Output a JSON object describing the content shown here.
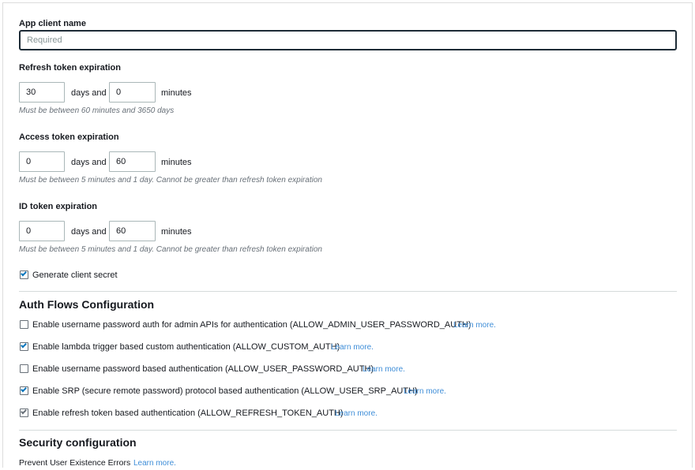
{
  "app_client": {
    "label": "App client name",
    "placeholder": "Required",
    "value": ""
  },
  "refresh_token": {
    "label": "Refresh token expiration",
    "days": "30",
    "days_suffix": "days and",
    "minutes": "0",
    "minutes_suffix": "minutes",
    "hint": "Must be between 60 minutes and 3650 days"
  },
  "access_token": {
    "label": "Access token expiration",
    "days": "0",
    "days_suffix": "days and",
    "minutes": "60",
    "minutes_suffix": "minutes",
    "hint": "Must be between 5 minutes and 1 day. Cannot be greater than refresh token expiration"
  },
  "id_token": {
    "label": "ID token expiration",
    "days": "0",
    "days_suffix": "days and",
    "minutes": "60",
    "minutes_suffix": "minutes",
    "hint": "Must be between 5 minutes and 1 day. Cannot be greater than refresh token expiration"
  },
  "client_secret": {
    "label": "Generate client secret",
    "checked": true
  },
  "auth_flows": {
    "heading": "Auth Flows Configuration",
    "items": [
      {
        "label": "Enable username password auth for admin APIs for authentication (ALLOW_ADMIN_USER_PASSWORD_AUTH)",
        "link": "Learn more.",
        "checked": false
      },
      {
        "label": "Enable lambda trigger based custom authentication (ALLOW_CUSTOM_AUTH)",
        "link": "Learn more.",
        "checked": true
      },
      {
        "label": "Enable username password based authentication (ALLOW_USER_PASSWORD_AUTH)",
        "link": "Learn more.",
        "checked": false
      },
      {
        "label": "Enable SRP (secure remote password) protocol based authentication (ALLOW_USER_SRP_AUTH)",
        "link": "Learn more.",
        "checked": true
      },
      {
        "label": "Enable refresh token based authentication (ALLOW_REFRESH_TOKEN_AUTH)",
        "link": "Learn more.",
        "checked": true,
        "disabled": true
      }
    ]
  },
  "security": {
    "heading": "Security configuration",
    "prevent_label": "Prevent User Existence Errors",
    "link": "Learn more."
  },
  "colors": {
    "link": "#3f8ed8",
    "checkbox_tick": "#0073bb",
    "hint": "#687078",
    "divider": "#d5dbdb"
  }
}
